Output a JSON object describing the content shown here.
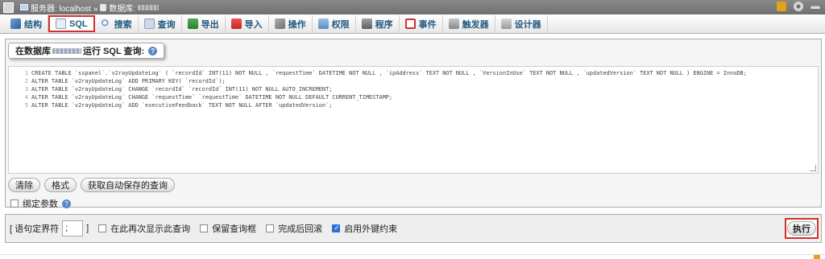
{
  "breadcrumb": {
    "server_label": "服务器: localhost »",
    "db_label": "数据库:"
  },
  "tabs": [
    {
      "label": "结构",
      "icon": "structure-icon",
      "active": false
    },
    {
      "label": "SQL",
      "icon": "sql-icon",
      "active": true
    },
    {
      "label": "搜索",
      "icon": "search-icon",
      "active": false
    },
    {
      "label": "查询",
      "icon": "query-icon",
      "active": false
    },
    {
      "label": "导出",
      "icon": "export-icon",
      "active": false
    },
    {
      "label": "导入",
      "icon": "import-icon",
      "active": false
    },
    {
      "label": "操作",
      "icon": "wrench-icon",
      "active": false
    },
    {
      "label": "权限",
      "icon": "privileges-icon",
      "active": false
    },
    {
      "label": "程序",
      "icon": "routines-icon",
      "active": false
    },
    {
      "label": "事件",
      "icon": "events-icon",
      "active": false
    },
    {
      "label": "触发器",
      "icon": "triggers-icon",
      "active": false
    },
    {
      "label": "设计器",
      "icon": "designer-icon",
      "active": false
    }
  ],
  "query_panel": {
    "legend_prefix": "在数据库",
    "legend_suffix": "运行 SQL 查询:",
    "lines": [
      "CREATE TABLE `sspanel`.`v2rayUpdateLog` ( `recordId` INT(11) NOT NULL , `requestTime` DATETIME NOT NULL , `ipAddress` TEXT NOT NULL , `VersionInUse` TEXT NOT NULL , `updatedVersion` TEXT NOT NULL ) ENGINE = InnoDB;",
      "ALTER TABLE `v2rayUpdateLog` ADD PRIMARY KEY( `recordId`);",
      "ALTER TABLE `v2rayUpdateLog` CHANGE `recordId` `recordId` INT(11) NOT NULL AUTO_INCREMENT;",
      "ALTER TABLE `v2rayUpdateLog` CHANGE `requestTime` `requestTime` DATETIME NOT NULL DEFAULT CURRENT_TIMESTAMP;",
      "ALTER TABLE `v2rayUpdateLog` ADD `executiveFeedback` TEXT NOT NULL AFTER `updatedVersion`;"
    ],
    "buttons": {
      "clear": "清除",
      "format": "格式",
      "get_autosaved": "获取自动保存的查询"
    },
    "bind_params_label": "绑定参数"
  },
  "options": {
    "delimiter_label_left": "[ 语句定界符",
    "delimiter_value": ";",
    "delimiter_label_right": "]",
    "show_query_again": {
      "label": "在此再次显示此查询",
      "checked": false
    },
    "retain_query_box": {
      "label": "保留查询框",
      "checked": false
    },
    "rollback_when_finished": {
      "label": "完成后回滚",
      "checked": false
    },
    "enable_foreign_keys": {
      "label": "启用外键约束",
      "checked": true
    },
    "go_button": "执行"
  },
  "colors": {
    "highlight": "#d32f2f",
    "tab_text": "#235a81"
  }
}
